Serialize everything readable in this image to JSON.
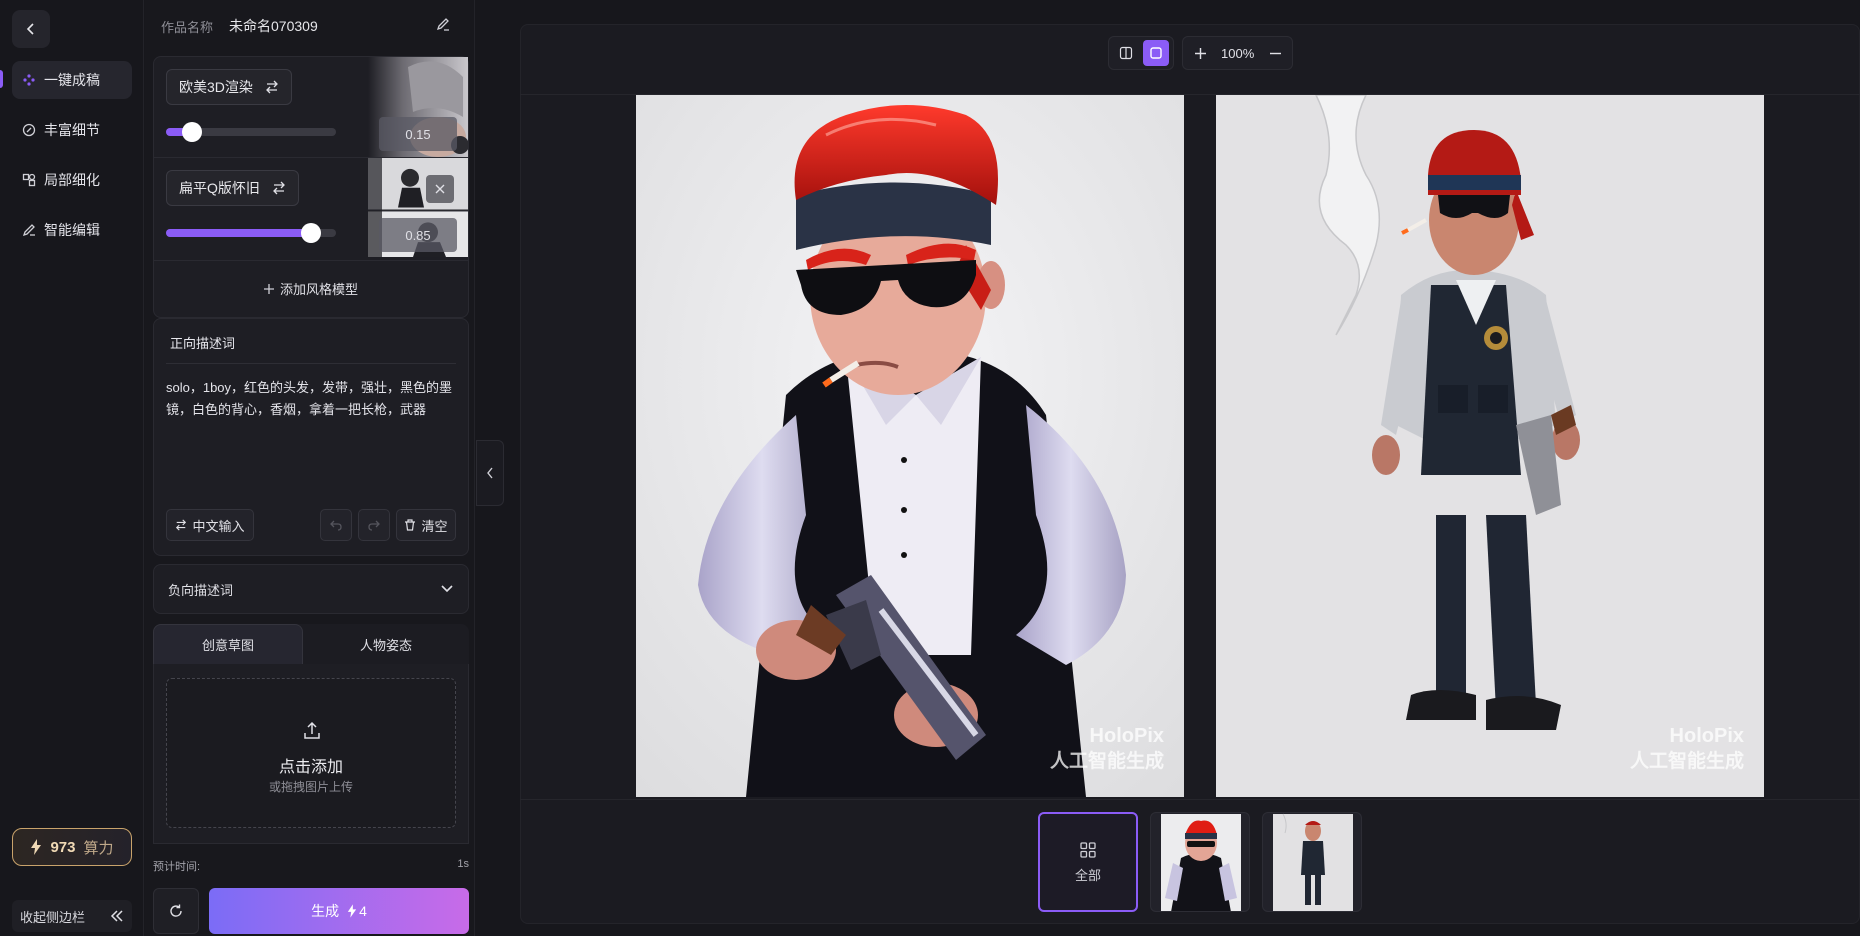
{
  "nav": {
    "items": [
      {
        "label": "一键成稿",
        "icon": "sparkle-icon",
        "active": true
      },
      {
        "label": "丰富细节",
        "icon": "detail-icon",
        "active": false
      },
      {
        "label": "局部细化",
        "icon": "region-icon",
        "active": false
      },
      {
        "label": "智能编辑",
        "icon": "pencil-icon",
        "active": false
      }
    ],
    "power_value": "973",
    "power_unit": "算力",
    "collapse_label": "收起侧边栏"
  },
  "work": {
    "name_label": "作品名称",
    "name_value": "未命名070309"
  },
  "styles": [
    {
      "name": "欧美3D渲染",
      "weight": 0.15,
      "weight_label": "0.15"
    },
    {
      "name": "扁平Q版怀旧",
      "weight": 0.85,
      "weight_label": "0.85"
    }
  ],
  "add_model_label": "添加风格模型",
  "prompt": {
    "title": "正向描述词",
    "text": "solo，1boy，红色的头发，发带，强壮，黑色的墨镜，白色的背心，香烟，拿着一把长枪，武器",
    "cn_input_label": "中文输入",
    "clear_label": "清空"
  },
  "negative_prompt_label": "负向描述词",
  "tabs": [
    {
      "label": "创意草图",
      "active": true
    },
    {
      "label": "人物姿态",
      "active": false
    }
  ],
  "upload": {
    "title": "点击添加",
    "subtitle": "或拖拽图片上传"
  },
  "estimate": {
    "label": "预计时间:",
    "value": "1s"
  },
  "generate": {
    "label": "生成",
    "cost": "4"
  },
  "toolbar": {
    "zoom": "100%"
  },
  "watermark": {
    "line1": "HoloPix",
    "line2": "人工智能生成"
  },
  "thumbs": {
    "all_label": "全部"
  },
  "colors": {
    "accent": "#8b5cf6",
    "gold": "#c9a36b"
  }
}
